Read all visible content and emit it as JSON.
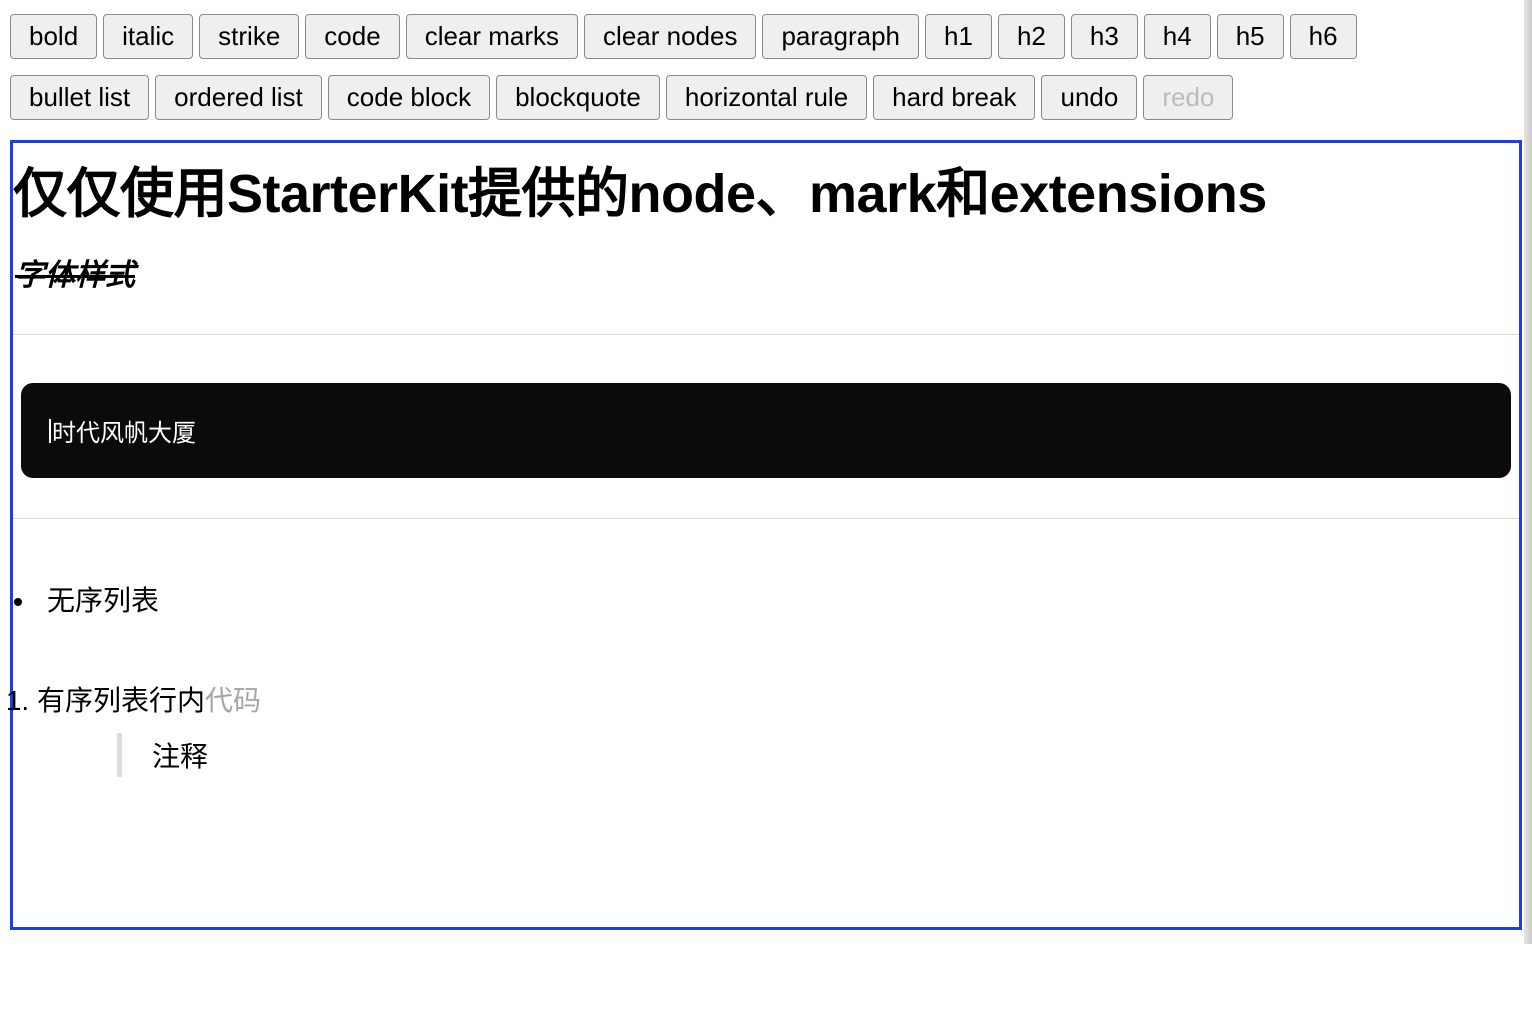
{
  "toolbar": {
    "row1": [
      {
        "key": "bold",
        "label": "bold",
        "disabled": false
      },
      {
        "key": "italic",
        "label": "italic",
        "disabled": false
      },
      {
        "key": "strike",
        "label": "strike",
        "disabled": false
      },
      {
        "key": "code",
        "label": "code",
        "disabled": false
      },
      {
        "key": "clear-marks",
        "label": "clear marks",
        "disabled": false
      },
      {
        "key": "clear-nodes",
        "label": "clear nodes",
        "disabled": false
      },
      {
        "key": "paragraph",
        "label": "paragraph",
        "disabled": false
      },
      {
        "key": "h1",
        "label": "h1",
        "disabled": false
      },
      {
        "key": "h2",
        "label": "h2",
        "disabled": false
      },
      {
        "key": "h3",
        "label": "h3",
        "disabled": false
      },
      {
        "key": "h4",
        "label": "h4",
        "disabled": false
      },
      {
        "key": "h5",
        "label": "h5",
        "disabled": false
      },
      {
        "key": "h6",
        "label": "h6",
        "disabled": false
      }
    ],
    "row2": [
      {
        "key": "bullet-list",
        "label": "bullet list",
        "disabled": false
      },
      {
        "key": "ordered-list",
        "label": "ordered list",
        "disabled": false
      },
      {
        "key": "code-block",
        "label": "code block",
        "disabled": false
      },
      {
        "key": "blockquote",
        "label": "blockquote",
        "disabled": false
      },
      {
        "key": "horizontal-rule",
        "label": "horizontal rule",
        "disabled": false
      },
      {
        "key": "hard-break",
        "label": "hard break",
        "disabled": false
      },
      {
        "key": "undo",
        "label": "undo",
        "disabled": false
      },
      {
        "key": "redo",
        "label": "redo",
        "disabled": true
      }
    ]
  },
  "editor": {
    "heading": "仅仅使用StarterKit提供的node、mark和extensions",
    "styled_paragraph": "字体样式",
    "code_block": "时代风帆大厦",
    "bullet_item": "无序列表",
    "ordered_item_text": "有序列表行内",
    "ordered_item_code": "代码",
    "blockquote": "注释"
  }
}
